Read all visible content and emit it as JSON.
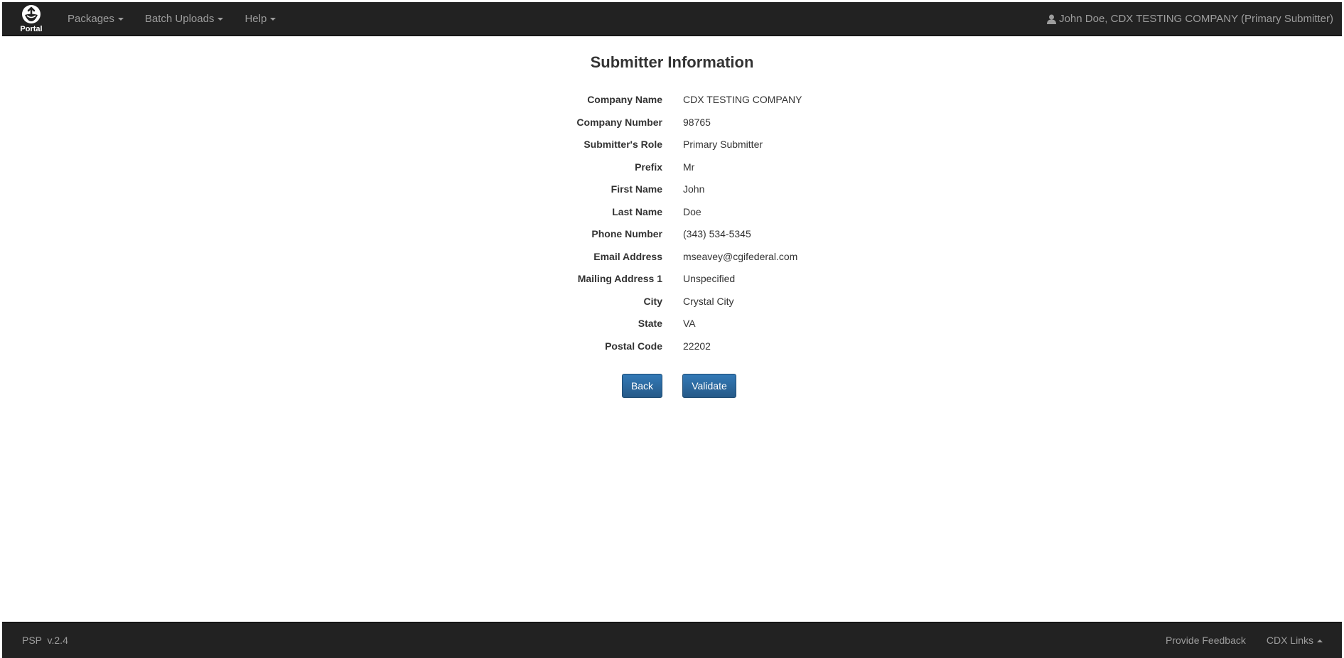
{
  "navbar": {
    "brand_label": "Portal",
    "brand_icon": "portal-logo-icon",
    "menu": [
      {
        "label": "Packages"
      },
      {
        "label": "Batch Uploads"
      },
      {
        "label": "Help"
      }
    ],
    "user_icon": "user-icon",
    "user_text": "John Doe, CDX TESTING COMPANY (Primary Submitter)"
  },
  "main": {
    "title": "Submitter Information",
    "fields": [
      {
        "label": "Company Name",
        "value": "CDX TESTING COMPANY"
      },
      {
        "label": "Company Number",
        "value": "98765"
      },
      {
        "label": "Submitter's Role",
        "value": "Primary Submitter"
      },
      {
        "label": "Prefix",
        "value": "Mr"
      },
      {
        "label": "First Name",
        "value": "John"
      },
      {
        "label": "Last Name",
        "value": "Doe"
      },
      {
        "label": "Phone Number",
        "value": "(343) 534-5345"
      },
      {
        "label": "Email Address",
        "value": "mseavey@cgifederal.com"
      },
      {
        "label": "Mailing Address 1",
        "value": "Unspecified"
      },
      {
        "label": "City",
        "value": "Crystal City"
      },
      {
        "label": "State",
        "value": "VA"
      },
      {
        "label": "Postal Code",
        "value": "22202"
      }
    ],
    "back_label": "Back",
    "validate_label": "Validate"
  },
  "footer": {
    "version": "PSP  v.2.4",
    "feedback_label": "Provide Feedback",
    "cdx_links_label": "CDX Links"
  },
  "colors": {
    "navbar_bg": "#222222",
    "nav_text": "#9d9d9d",
    "button_primary": "#337ab7",
    "text": "#333333"
  }
}
